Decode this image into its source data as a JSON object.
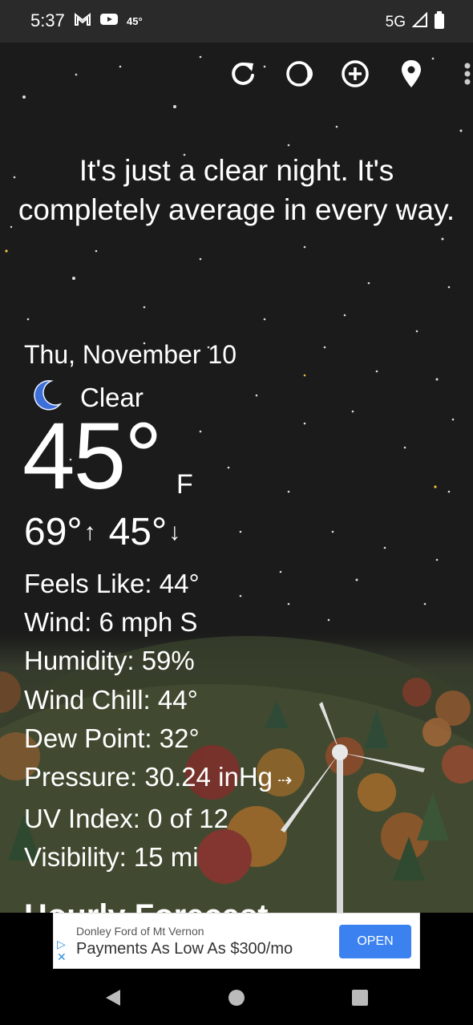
{
  "status_bar": {
    "time": "5:37",
    "temp": "45°",
    "network": "5G"
  },
  "toolbar": {
    "icons": [
      "refresh-icon",
      "moon-phase-icon",
      "add-location-icon",
      "location-pin-icon",
      "more-vert-icon"
    ]
  },
  "headline": "It's just a clear night. It's completely average in every way.",
  "current": {
    "date": "Thu, November 10",
    "condition": "Clear",
    "temp": "45°",
    "unit": "F",
    "high": "69°",
    "low": "45°"
  },
  "details": {
    "feels_like": "Feels Like:  44°",
    "wind": "Wind:  6 mph S",
    "humidity": "Humidity:  59%",
    "wind_chill": "Wind Chill:  44°",
    "dew_point": "Dew Point:  32°",
    "pressure": "Pressure:  30.24 inHg",
    "uv_index": "UV Index:  0 of 12",
    "visibility": "Visibility:  15 mi"
  },
  "hourly_heading": "Hourly Forecast",
  "ad": {
    "advertiser": "Donley Ford of Mt Vernon",
    "headline": "Payments As Low As $300/mo",
    "cta": "OPEN"
  },
  "colors": {
    "ad_button": "#3b82f0",
    "moon_icon": "#3d6fd9"
  }
}
